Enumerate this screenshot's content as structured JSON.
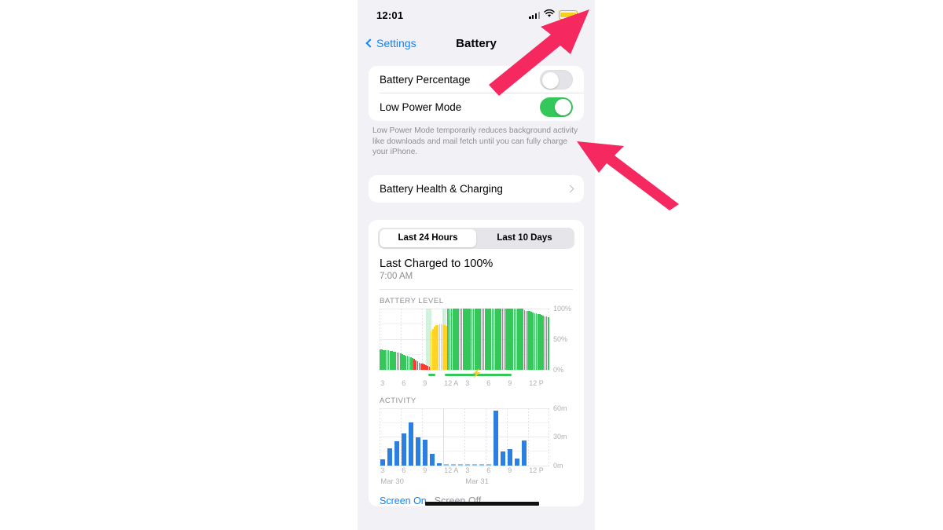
{
  "status_bar": {
    "time": "12:01",
    "cellular_icon": "cellular-bars-icon",
    "wifi_icon": "wifi-icon",
    "battery_icon": "battery-low-power-icon"
  },
  "nav": {
    "back_label": "Settings",
    "title": "Battery",
    "back_icon": "chevron-left-icon"
  },
  "settings": {
    "battery_percentage": {
      "label": "Battery Percentage",
      "state": "off"
    },
    "low_power_mode": {
      "label": "Low Power Mode",
      "state": "on"
    },
    "footnote": "Low Power Mode temporarily reduces background activity like downloads and mail fetch until you can fully charge your iPhone.",
    "battery_health": {
      "label": "Battery Health & Charging",
      "chevron": "chevron-right-icon"
    }
  },
  "usage": {
    "segments": [
      {
        "label": "Last 24 Hours",
        "active": true
      },
      {
        "label": "Last 10 Days",
        "active": false
      }
    ],
    "last_charged_title": "Last Charged to 100%",
    "last_charged_time": "7:00 AM",
    "battery_level_header": "BATTERY LEVEL",
    "activity_header": "ACTIVITY",
    "legend_screen_on": "Screen On",
    "legend_screen_off": "Screen Off"
  },
  "colors": {
    "accent_blue": "#0a84ff",
    "toggle_green": "#34c759",
    "battery_yellow": "#f7cf1e",
    "chart_green": "#35c759",
    "chart_yellow": "#ffd426",
    "chart_red": "#ff3b30",
    "chart_blue": "#2a7fe0",
    "arrow_pink": "#f5285f",
    "group_bg": "#f2f1f6"
  },
  "chart_data": [
    {
      "type": "bar",
      "title": "BATTERY LEVEL",
      "xlabel": "",
      "ylabel": "",
      "ylim": [
        0,
        100
      ],
      "ytick_labels": [
        "0%",
        "50%",
        "100%"
      ],
      "yticks": [
        0,
        50,
        100
      ],
      "xtick_labels": [
        "3",
        "6",
        "9",
        "12 A",
        "3",
        "6",
        "9",
        "12 P"
      ],
      "grid": true,
      "legend_position": "none",
      "note": "values are battery percentage per ~10 minute bucket across 24 hours; color encodes state",
      "values": [
        33,
        33,
        32,
        32,
        31,
        31,
        30,
        30,
        29,
        29,
        28,
        27,
        26,
        25,
        24,
        23,
        22,
        21,
        20,
        19,
        17,
        15,
        13,
        11,
        10,
        9,
        8,
        7,
        6,
        5,
        62,
        66,
        70,
        72,
        73,
        74,
        74,
        73,
        72,
        71,
        100,
        100,
        100,
        100,
        100,
        100,
        100,
        100,
        100,
        100,
        100,
        100,
        100,
        100,
        100,
        100,
        100,
        100,
        100,
        100,
        100,
        100,
        100,
        100,
        100,
        100,
        100,
        100,
        100,
        100,
        100,
        100,
        100,
        100,
        100,
        100,
        100,
        100,
        100,
        100,
        100,
        100,
        100,
        100,
        99,
        97,
        96,
        95,
        95,
        94,
        93,
        92,
        92,
        91,
        90,
        89,
        88,
        87,
        86,
        85
      ],
      "colors": [
        "green",
        "green",
        "green",
        "green",
        "green",
        "green",
        "green",
        "green",
        "green",
        "green",
        "green",
        "green",
        "green",
        "green",
        "green",
        "green",
        "green",
        "green",
        "green",
        "green",
        "red",
        "red",
        "red",
        "red",
        "red",
        "red",
        "red",
        "red",
        "red",
        "red",
        "yellow",
        "yellow",
        "yellow",
        "yellow",
        "yellow",
        "yellow",
        "yellow",
        "yellow",
        "yellow",
        "yellow",
        "green",
        "green",
        "green",
        "green",
        "green",
        "green",
        "green",
        "green",
        "green",
        "green",
        "green",
        "green",
        "green",
        "green",
        "green",
        "green",
        "green",
        "green",
        "green",
        "green",
        "green",
        "green",
        "green",
        "green",
        "green",
        "green",
        "green",
        "green",
        "green",
        "green",
        "green",
        "green",
        "green",
        "green",
        "green",
        "green",
        "green",
        "green",
        "green",
        "green",
        "green",
        "green",
        "green",
        "green",
        "green",
        "green",
        "green",
        "green",
        "green",
        "green",
        "green",
        "green",
        "green",
        "green",
        "green",
        "green",
        "green",
        "green",
        "green",
        "green"
      ],
      "charging_segments": [
        [
          28.5,
          33.0
        ],
        [
          38.5,
          78.0
        ]
      ],
      "highlight_bands": [
        [
          27.5,
          30.5
        ],
        [
          37.0,
          39.5
        ]
      ],
      "bolt_icon": "lightning-bolt-icon"
    },
    {
      "type": "bar",
      "title": "ACTIVITY",
      "xlabel": "",
      "ylabel": "",
      "ylim": [
        0,
        60
      ],
      "ytick_labels": [
        "0m",
        "30m",
        "60m"
      ],
      "yticks": [
        0,
        30,
        60
      ],
      "xtick_labels": [
        "3",
        "6",
        "9",
        "12 A",
        "3",
        "6",
        "9",
        "12 P"
      ],
      "date_labels": [
        "Mar 30",
        "Mar 31"
      ],
      "grid": true,
      "legend_position": "bottom",
      "note": "screen-on minutes per hourly bucket",
      "categories": [
        "1",
        "2",
        "3",
        "4",
        "5",
        "6",
        "7",
        "8",
        "9",
        "10",
        "11",
        "12",
        "13",
        "14",
        "15",
        "16",
        "17",
        "18",
        "19",
        "20",
        "21",
        "22",
        "23",
        "24"
      ],
      "values": [
        6,
        18,
        25,
        33,
        45,
        29,
        27,
        12,
        2,
        0.6,
        0.6,
        0.6,
        0.6,
        0.6,
        0.6,
        0.6,
        57,
        14,
        17,
        7,
        26,
        0,
        0,
        0
      ]
    }
  ],
  "annotations": [
    {
      "name": "arrow-to-battery-icon",
      "target": "status-bar battery icon",
      "color": "#f5285f"
    },
    {
      "name": "arrow-to-low-power-mode",
      "target": "Low Power Mode toggle",
      "color": "#f5285f"
    }
  ]
}
